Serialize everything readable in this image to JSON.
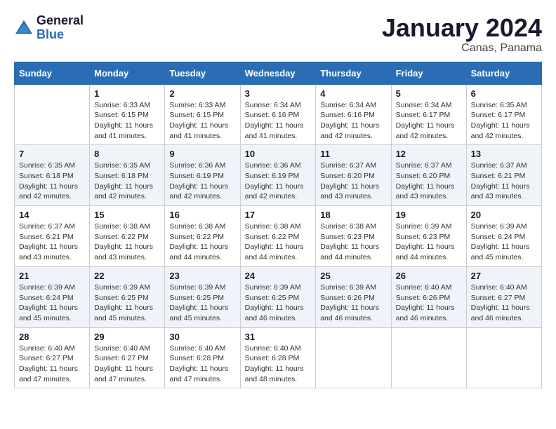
{
  "logo": {
    "name1": "General",
    "name2": "Blue"
  },
  "title": "January 2024",
  "location": "Canas, Panama",
  "days_of_week": [
    "Sunday",
    "Monday",
    "Tuesday",
    "Wednesday",
    "Thursday",
    "Friday",
    "Saturday"
  ],
  "weeks": [
    [
      {
        "day": "",
        "info": ""
      },
      {
        "day": "1",
        "info": "Sunrise: 6:33 AM\nSunset: 6:15 PM\nDaylight: 11 hours\nand 41 minutes."
      },
      {
        "day": "2",
        "info": "Sunrise: 6:33 AM\nSunset: 6:15 PM\nDaylight: 11 hours\nand 41 minutes."
      },
      {
        "day": "3",
        "info": "Sunrise: 6:34 AM\nSunset: 6:16 PM\nDaylight: 11 hours\nand 41 minutes."
      },
      {
        "day": "4",
        "info": "Sunrise: 6:34 AM\nSunset: 6:16 PM\nDaylight: 11 hours\nand 42 minutes."
      },
      {
        "day": "5",
        "info": "Sunrise: 6:34 AM\nSunset: 6:17 PM\nDaylight: 11 hours\nand 42 minutes."
      },
      {
        "day": "6",
        "info": "Sunrise: 6:35 AM\nSunset: 6:17 PM\nDaylight: 11 hours\nand 42 minutes."
      }
    ],
    [
      {
        "day": "7",
        "info": "Sunrise: 6:35 AM\nSunset: 6:18 PM\nDaylight: 11 hours\nand 42 minutes."
      },
      {
        "day": "8",
        "info": "Sunrise: 6:35 AM\nSunset: 6:18 PM\nDaylight: 11 hours\nand 42 minutes."
      },
      {
        "day": "9",
        "info": "Sunrise: 6:36 AM\nSunset: 6:19 PM\nDaylight: 11 hours\nand 42 minutes."
      },
      {
        "day": "10",
        "info": "Sunrise: 6:36 AM\nSunset: 6:19 PM\nDaylight: 11 hours\nand 42 minutes."
      },
      {
        "day": "11",
        "info": "Sunrise: 6:37 AM\nSunset: 6:20 PM\nDaylight: 11 hours\nand 43 minutes."
      },
      {
        "day": "12",
        "info": "Sunrise: 6:37 AM\nSunset: 6:20 PM\nDaylight: 11 hours\nand 43 minutes."
      },
      {
        "day": "13",
        "info": "Sunrise: 6:37 AM\nSunset: 6:21 PM\nDaylight: 11 hours\nand 43 minutes."
      }
    ],
    [
      {
        "day": "14",
        "info": "Sunrise: 6:37 AM\nSunset: 6:21 PM\nDaylight: 11 hours\nand 43 minutes."
      },
      {
        "day": "15",
        "info": "Sunrise: 6:38 AM\nSunset: 6:22 PM\nDaylight: 11 hours\nand 43 minutes."
      },
      {
        "day": "16",
        "info": "Sunrise: 6:38 AM\nSunset: 6:22 PM\nDaylight: 11 hours\nand 44 minutes."
      },
      {
        "day": "17",
        "info": "Sunrise: 6:38 AM\nSunset: 6:22 PM\nDaylight: 11 hours\nand 44 minutes."
      },
      {
        "day": "18",
        "info": "Sunrise: 6:38 AM\nSunset: 6:23 PM\nDaylight: 11 hours\nand 44 minutes."
      },
      {
        "day": "19",
        "info": "Sunrise: 6:39 AM\nSunset: 6:23 PM\nDaylight: 11 hours\nand 44 minutes."
      },
      {
        "day": "20",
        "info": "Sunrise: 6:39 AM\nSunset: 6:24 PM\nDaylight: 11 hours\nand 45 minutes."
      }
    ],
    [
      {
        "day": "21",
        "info": "Sunrise: 6:39 AM\nSunset: 6:24 PM\nDaylight: 11 hours\nand 45 minutes."
      },
      {
        "day": "22",
        "info": "Sunrise: 6:39 AM\nSunset: 6:25 PM\nDaylight: 11 hours\nand 45 minutes."
      },
      {
        "day": "23",
        "info": "Sunrise: 6:39 AM\nSunset: 6:25 PM\nDaylight: 11 hours\nand 45 minutes."
      },
      {
        "day": "24",
        "info": "Sunrise: 6:39 AM\nSunset: 6:25 PM\nDaylight: 11 hours\nand 46 minutes."
      },
      {
        "day": "25",
        "info": "Sunrise: 6:39 AM\nSunset: 6:26 PM\nDaylight: 11 hours\nand 46 minutes."
      },
      {
        "day": "26",
        "info": "Sunrise: 6:40 AM\nSunset: 6:26 PM\nDaylight: 11 hours\nand 46 minutes."
      },
      {
        "day": "27",
        "info": "Sunrise: 6:40 AM\nSunset: 6:27 PM\nDaylight: 11 hours\nand 46 minutes."
      }
    ],
    [
      {
        "day": "28",
        "info": "Sunrise: 6:40 AM\nSunset: 6:27 PM\nDaylight: 11 hours\nand 47 minutes."
      },
      {
        "day": "29",
        "info": "Sunrise: 6:40 AM\nSunset: 6:27 PM\nDaylight: 11 hours\nand 47 minutes."
      },
      {
        "day": "30",
        "info": "Sunrise: 6:40 AM\nSunset: 6:28 PM\nDaylight: 11 hours\nand 47 minutes."
      },
      {
        "day": "31",
        "info": "Sunrise: 6:40 AM\nSunset: 6:28 PM\nDaylight: 11 hours\nand 48 minutes."
      },
      {
        "day": "",
        "info": ""
      },
      {
        "day": "",
        "info": ""
      },
      {
        "day": "",
        "info": ""
      }
    ]
  ]
}
